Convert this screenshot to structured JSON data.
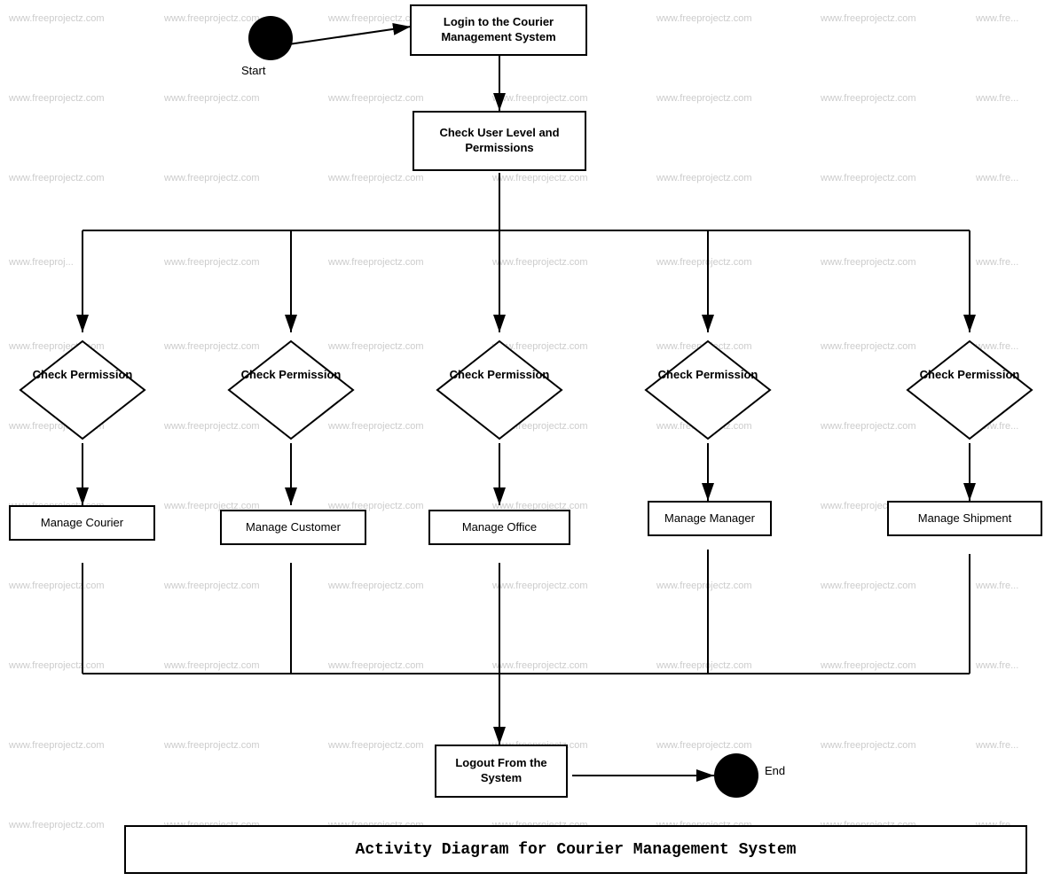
{
  "watermarks": [
    "www.freeprojectz.com"
  ],
  "diagram": {
    "title": "Activity Diagram for Courier Management System",
    "nodes": {
      "start_label": "Start",
      "end_label": "End",
      "login": "Login to the Courier\nManagement System",
      "check_user_level": "Check User Level and\nPermissions",
      "check_permission_1": "Check\nPermission",
      "check_permission_2": "Check\nPermission",
      "check_permission_3": "Check\nPermission",
      "check_permission_4": "Check\nPermission",
      "check_permission_5": "Check\nPermission",
      "manage_courier": "Manage Courier",
      "manage_customer": "Manage Customer",
      "manage_office": "Manage Office",
      "manage_manager": "Manage Manager",
      "manage_shipment": "Manage Shipment",
      "logout": "Logout From the\nSystem"
    }
  }
}
